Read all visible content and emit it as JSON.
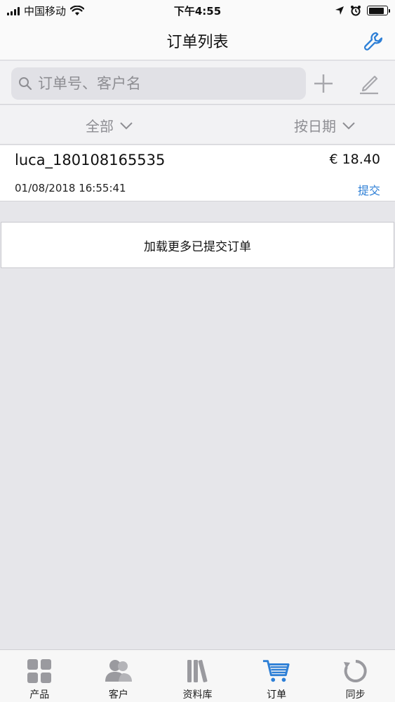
{
  "status_bar": {
    "carrier": "中国移动",
    "time": "下午4:55",
    "battery_percent": 85
  },
  "nav": {
    "title": "订单列表",
    "settings_icon": "wrench-icon"
  },
  "search": {
    "placeholder": "订单号、客户名",
    "value": ""
  },
  "filters": {
    "status_label": "全部",
    "sort_label": "按日期"
  },
  "orders": [
    {
      "id": "luca_180108165535",
      "amount": "€ 18.40",
      "date": "01/08/2018 16:55:41",
      "status": "提交"
    }
  ],
  "load_more_label": "加载更多已提交订单",
  "tabs": [
    {
      "label": "产品",
      "icon": "grid-icon"
    },
    {
      "label": "客户",
      "icon": "people-icon"
    },
    {
      "label": "资料库",
      "icon": "books-icon"
    },
    {
      "label": "订单",
      "icon": "cart-icon",
      "active": true
    },
    {
      "label": "同步",
      "icon": "sync-icon"
    }
  ],
  "colors": {
    "accent": "#2d7fd6",
    "inactive_icon": "#8e8e93",
    "background": "#e6e6ea"
  }
}
